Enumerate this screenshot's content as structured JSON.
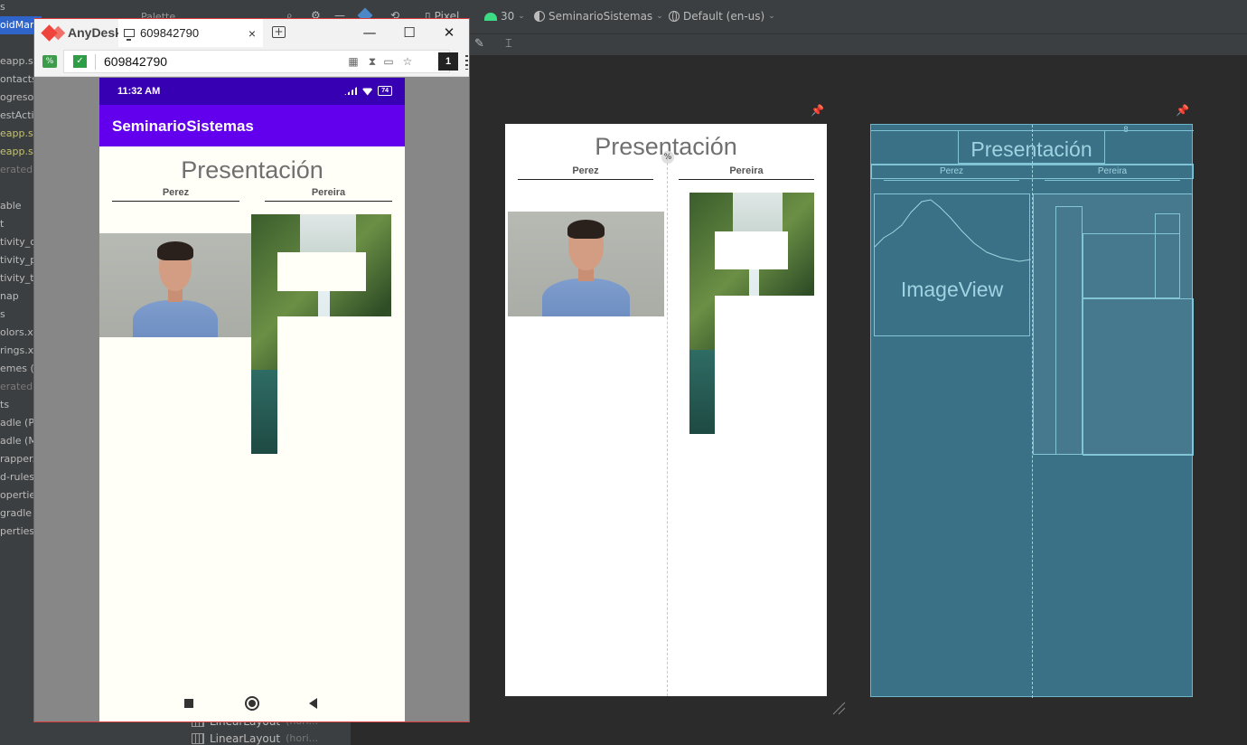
{
  "ide": {
    "project_items": [
      {
        "label": "s",
        "style": ""
      },
      {
        "label": "oidMan",
        "style": "sel"
      },
      {
        "label": "eapp.se",
        "style": ""
      },
      {
        "label": "ontacts",
        "style": ""
      },
      {
        "label": "ogreso",
        "style": ""
      },
      {
        "label": "estActiv",
        "style": ""
      },
      {
        "label": "eapp.se",
        "style": "hl"
      },
      {
        "label": "eapp.se",
        "style": "hl"
      },
      {
        "label": "erated)",
        "style": "dim"
      },
      {
        "label": "able",
        "style": ""
      },
      {
        "label": "t",
        "style": ""
      },
      {
        "label": "tivity_c",
        "style": ""
      },
      {
        "label": "tivity_p",
        "style": ""
      },
      {
        "label": "tivity_t",
        "style": ""
      },
      {
        "label": "nap",
        "style": ""
      },
      {
        "label": "s",
        "style": ""
      },
      {
        "label": "olors.xm",
        "style": ""
      },
      {
        "label": "rings.xm",
        "style": ""
      },
      {
        "label": "emes (2",
        "style": ""
      },
      {
        "label": "erated)",
        "style": "dim"
      },
      {
        "label": "ts",
        "style": ""
      },
      {
        "label": "adle (Pro",
        "style": ""
      },
      {
        "label": "adle (Mo",
        "style": ""
      },
      {
        "label": "rapper.",
        "style": ""
      },
      {
        "label": "d-rules.p",
        "style": ""
      },
      {
        "label": "opertie",
        "style": ""
      },
      {
        "label": "gradle (",
        "style": ""
      },
      {
        "label": "perties",
        "style": ""
      }
    ],
    "toolbar": {
      "palette": "Palette",
      "device": "Pixel",
      "api": "30",
      "theme": "SeminarioSistemas",
      "locale": "Default (en-us)"
    },
    "component_tree": [
      {
        "label": "LinearLayout",
        "hint": "(hori..."
      },
      {
        "label": "LinearLayout",
        "hint": "(hori..."
      }
    ]
  },
  "design": {
    "title": "Presentación",
    "name_left": "Perez",
    "name_right": "Pereira",
    "percent_marker": "%"
  },
  "blueprint": {
    "title": "Presentación",
    "name_left": "Perez",
    "name_right": "Pereira",
    "image_label": "ImageView",
    "small_number": "8"
  },
  "anydesk": {
    "app_name": "AnyDesk",
    "tab_label": "609842790",
    "tab_close": "×",
    "address": "609842790",
    "session_count": "1",
    "win_min": "—",
    "win_max": "☐",
    "win_close": "✕"
  },
  "phone": {
    "time": "11:32 AM",
    "battery": "74",
    "app_title": "SeminarioSistemas",
    "title": "Presentación",
    "name_left": "Perez",
    "name_right": "Pereira"
  },
  "colors": {
    "app_bar": "#6200ee",
    "status_bar": "#3700b3",
    "blueprint_bg": "#3b7186",
    "anydesk_accent": "#ef443b"
  }
}
